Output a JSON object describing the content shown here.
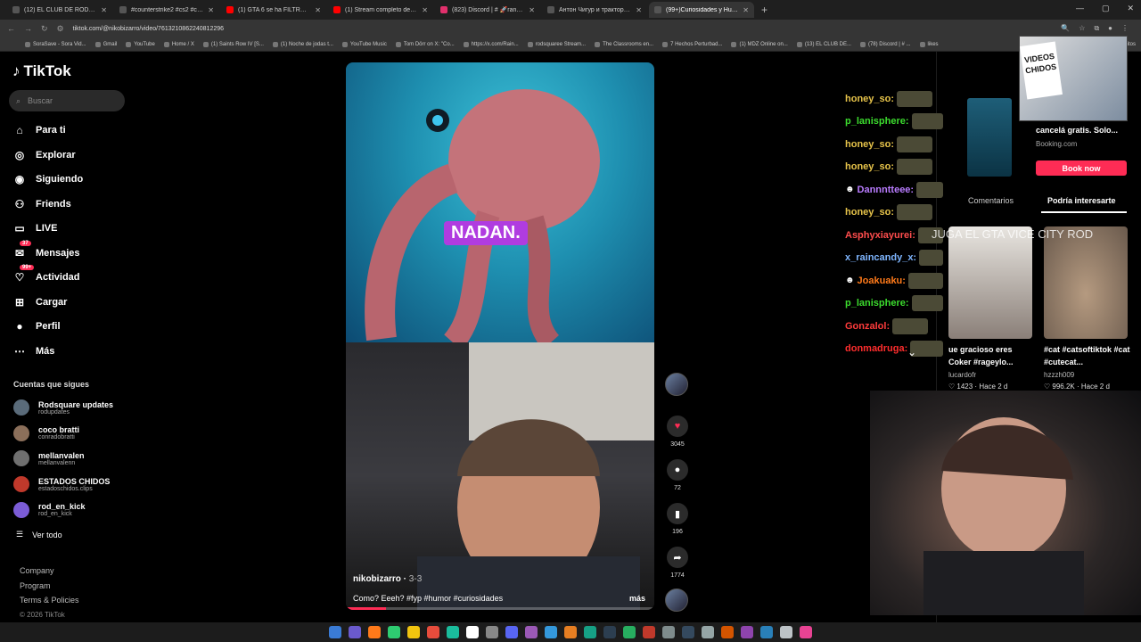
{
  "browser": {
    "tabs": [
      {
        "title": "(12) EL CLUB DE RODSQUAR",
        "color": "#111"
      },
      {
        "title": "#counterstrike2 #cs2 #csgom",
        "color": "#111"
      },
      {
        "title": "(1) GTA 6 se ha FILTRADO - Yo",
        "color": "#ff0000"
      },
      {
        "title": "(1) Stream completo de @Coc",
        "color": "#ff0000"
      },
      {
        "title": "(823) Discord | # 🚀random 🚀",
        "color": "#e1306c"
      },
      {
        "title": "Антон Чигур и тракторы в дв",
        "color": "#111"
      },
      {
        "title": "(99+)Curiosidades y Humo",
        "color": "#111"
      }
    ],
    "url": "tiktok.com/@nikobizarro/video/7613210862240812296",
    "bookmarks": [
      "SoraSave - Sora Vid...",
      "Gmail",
      "YouTube",
      "Home / X",
      "(1) Saints Row IV [S...",
      "(1) Noche de jodas t...",
      "YouTube Music",
      "Tom Dörr on X: \"Co...",
      "https://x.com/Rain...",
      "rodsquaree Stream...",
      "The Classrooms en...",
      "7 Hechos Perturbad...",
      "(1) MDZ Online on...",
      "(13) EL CLUB DE...",
      "(78) Discord | # ...",
      "likes"
    ],
    "bookmarks_trailing": "avoritos"
  },
  "sidebar": {
    "logo": "TikTok",
    "search_placeholder": "Buscar",
    "nav": [
      {
        "label": "Para ti",
        "icon": "home-icon"
      },
      {
        "label": "Explorar",
        "icon": "compass-icon"
      },
      {
        "label": "Siguiendo",
        "icon": "following-icon"
      },
      {
        "label": "Friends",
        "icon": "friends-icon"
      },
      {
        "label": "LIVE",
        "icon": "live-icon"
      },
      {
        "label": "Mensajes",
        "icon": "messages-icon",
        "badge": "37"
      },
      {
        "label": "Actividad",
        "icon": "activity-icon",
        "badge": "99+"
      },
      {
        "label": "Cargar",
        "icon": "upload-icon"
      },
      {
        "label": "Perfil",
        "icon": "profile-icon"
      },
      {
        "label": "Más",
        "icon": "more-icon"
      }
    ],
    "following_title": "Cuentas que sigues",
    "following": [
      {
        "name": "Rodsquare updates",
        "handle": "rodupdates",
        "color": "#5a6b7a"
      },
      {
        "name": "coco bratti",
        "handle": "conradobratti",
        "color": "#8b6f5a"
      },
      {
        "name": "mellanvalen",
        "handle": "mellanvalenn",
        "color": "#6f6f6f"
      },
      {
        "name": "ESTADOS CHIDOS",
        "handle": "estadoschidos.clips",
        "color": "#c0392b"
      },
      {
        "name": "rod_en_kick",
        "handle": "rod_en_kick",
        "color": "#7b5cd6"
      }
    ],
    "see_all": "Ver todo",
    "footer": [
      "Company",
      "Program",
      "Terms & Policies"
    ],
    "copyright": "© 2026 TikTok"
  },
  "video": {
    "overlay_caption": "NADAN.",
    "author": "nikobizarro",
    "date": "3-3",
    "description": "Como? Eeeh? #fyp #humor #curiosidades",
    "more": "más",
    "progress": 0.13
  },
  "actions": {
    "likes": "3045",
    "comments": "72",
    "saves": "196",
    "shares": "1774"
  },
  "chat": [
    {
      "user": "honey_so:",
      "color": "#e6c34a",
      "badge": false
    },
    {
      "user": "p_lanisphere:",
      "color": "#3cdc2e",
      "badge": false
    },
    {
      "user": "honey_so:",
      "color": "#e6c34a",
      "badge": false
    },
    {
      "user": "honey_so:",
      "color": "#e6c34a",
      "badge": false
    },
    {
      "user": "Dannntteee:",
      "color": "#b97cff",
      "badge": true
    },
    {
      "user": "honey_so:",
      "color": "#e6c34a",
      "badge": false
    },
    {
      "user": "Asphyxiayurei:",
      "color": "#ff4d4d",
      "badge": false
    },
    {
      "user": "x_raincandy_x:",
      "color": "#7fb6ff",
      "badge": false
    },
    {
      "user": "Joakuaku:",
      "color": "#ff7a1a",
      "badge": true
    },
    {
      "user": "p_lanisphere:",
      "color": "#3cdc2e",
      "badge": false
    },
    {
      "user": "Gonzalol:",
      "color": "#ff3b3b",
      "badge": false
    },
    {
      "user": "donmadruga:",
      "color": "#ff2d2d",
      "badge": false
    }
  ],
  "overlay_message": "JUGA EL GTA VICE CITY ROD",
  "right_panel": {
    "ad_title": "cancelá gratis. Solo...",
    "ad_site": "Booking.com",
    "ad_button": "Book now",
    "tabs": [
      "Comentarios",
      "Podría interesarte"
    ],
    "cards": [
      {
        "title": "ue gracioso eres Coker #rageylo...",
        "author": "lucardofr",
        "likes": "1423",
        "time": "Hace 2 d"
      },
      {
        "title": "#cat #catsoftiktok #cat #cutecat...",
        "author": "hzzzh009",
        "likes": "996.2K",
        "time": "Hace 2 d"
      }
    ]
  },
  "webcam_sign": "VIDEOS CHIDOS",
  "colors": {
    "accent": "#fe2c55"
  }
}
